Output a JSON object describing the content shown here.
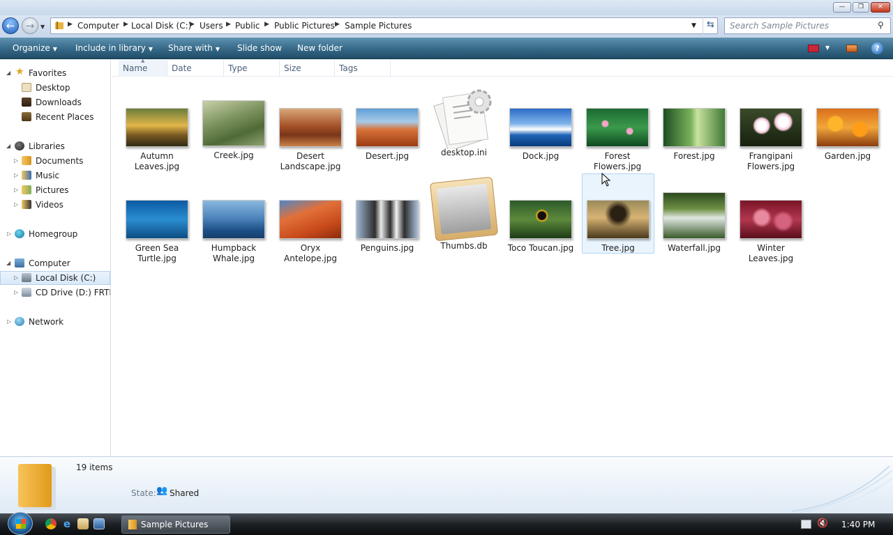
{
  "window": {
    "minimize": "—",
    "maximize": "❐",
    "close": "✕"
  },
  "address": {
    "crumbs": [
      "Computer",
      "Local Disk (C:)",
      "Users",
      "Public",
      "Public Pictures",
      "Sample Pictures"
    ]
  },
  "search": {
    "placeholder": "Search Sample Pictures"
  },
  "toolbar": {
    "organize": "Organize",
    "include": "Include in library",
    "share": "Share with",
    "slideshow": "Slide show",
    "newfolder": "New folder"
  },
  "sidebar": {
    "favorites": "Favorites",
    "desktop": "Desktop",
    "downloads": "Downloads",
    "recent": "Recent Places",
    "libraries": "Libraries",
    "documents": "Documents",
    "music": "Music",
    "pictures": "Pictures",
    "videos": "Videos",
    "homegroup": "Homegroup",
    "computer": "Computer",
    "localdisk": "Local Disk (C:)",
    "cddrive": "CD Drive (D:) FRTMEVOL_EN",
    "network": "Network"
  },
  "columns": [
    "Name",
    "Date",
    "Type",
    "Size",
    "Tags"
  ],
  "files": {
    "autumn": "Autumn Leaves.jpg",
    "creek": "Creek.jpg",
    "desertls": "Desert Landscape.jpg",
    "desert": "Desert.jpg",
    "desktopini": "desktop.ini",
    "dock": "Dock.jpg",
    "forestfl": "Forest Flowers.jpg",
    "forest": "Forest.jpg",
    "frangipani": "Frangipani Flowers.jpg",
    "garden": "Garden.jpg",
    "turtle": "Green Sea Turtle.jpg",
    "whale": "Humpback Whale.jpg",
    "oryx": "Oryx Antelope.jpg",
    "penguins": "Penguins.jpg",
    "thumbs": "Thumbs.db",
    "toucan": "Toco Toucan.jpg",
    "tree": "Tree.jpg",
    "waterfall": "Waterfall.jpg",
    "winter": "Winter Leaves.jpg"
  },
  "details": {
    "count": "19 items",
    "state_label": "State:",
    "state_value": "Shared"
  },
  "taskbar": {
    "window": "Sample Pictures",
    "clock": "1:40 PM"
  }
}
